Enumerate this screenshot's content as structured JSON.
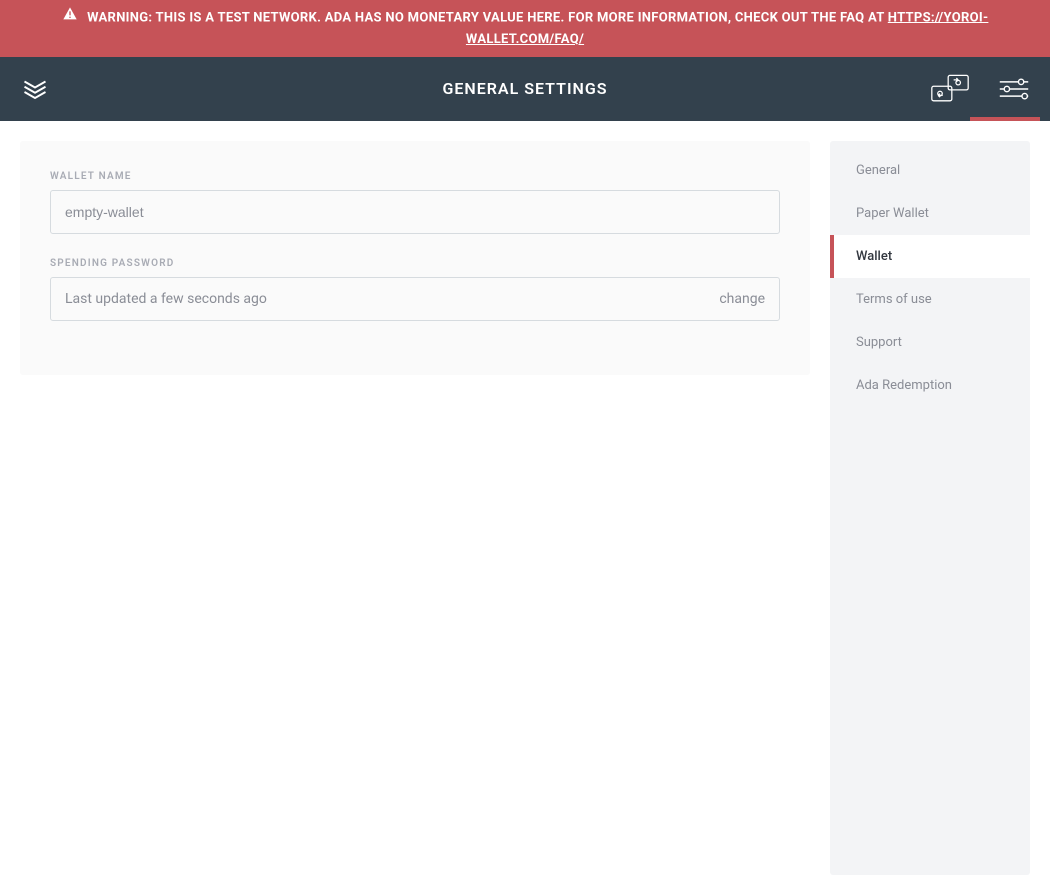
{
  "warning": {
    "icon": "warning-triangle",
    "text": "WARNING: THIS IS A TEST NETWORK. ADA HAS NO MONETARY VALUE HERE. FOR MORE INFORMATION, CHECK OUT THE FAQ AT ",
    "link_text": "HTTPS://YOROI-WALLET.COM/FAQ/"
  },
  "header": {
    "title": "GENERAL SETTINGS"
  },
  "main": {
    "wallet_name_label": "WALLET NAME",
    "wallet_name_value": "empty-wallet",
    "spending_password_label": "SPENDING PASSWORD",
    "spending_password_status": "Last updated a few seconds ago",
    "change_label": "change"
  },
  "sidebar": {
    "items": [
      {
        "label": "General",
        "active": false
      },
      {
        "label": "Paper Wallet",
        "active": false
      },
      {
        "label": "Wallet",
        "active": true
      },
      {
        "label": "Terms of use",
        "active": false
      },
      {
        "label": "Support",
        "active": false
      },
      {
        "label": "Ada Redemption",
        "active": false
      }
    ]
  }
}
